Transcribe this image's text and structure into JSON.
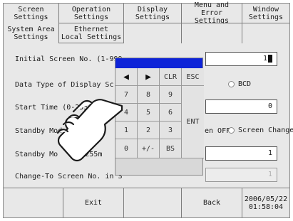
{
  "tabs_primary": [
    {
      "label": "Screen\nSettings"
    },
    {
      "label": "Operation\nSettings"
    },
    {
      "label": "Display\nSettings"
    },
    {
      "label": "Menu and\nError Settings"
    },
    {
      "label": "Window\nSettings"
    }
  ],
  "tabs_secondary": [
    {
      "label": "System Area\nSettings"
    },
    {
      "label": "Ethernet\nLocal Settings"
    }
  ],
  "settings": {
    "initial_screen_label": "Initial Screen No. (1-999",
    "initial_screen_value": "1",
    "data_type_label": "Data Type of Display Scre",
    "data_type_option_bcd": "BCD",
    "start_time_label": "Start Time (0-255",
    "start_time_label_tail": "c):",
    "start_time_value": "0",
    "standby_mode_label": "Standby Mode S",
    "standby_option_off": "en OFF",
    "standby_option_change": "Screen Change",
    "standby_time_label": "Standby Mo",
    "standby_time_label_tail": "1-255m",
    "standby_time_value": "1",
    "change_to_label": "Change-To Screen No. in S",
    "change_to_value": "1"
  },
  "keypad": {
    "left_arrow": "◀",
    "right_arrow": "▶",
    "clr": "CLR",
    "esc": "ESC",
    "k7": "7",
    "k8": "8",
    "k9": "9",
    "k4": "4",
    "k5": "5",
    "k6": "6",
    "k1": "1",
    "k2": "2",
    "k3": "3",
    "k0": "0",
    "plus_minus": "+/-",
    "bs": "BS",
    "ent": "ENT"
  },
  "bottom_bar": {
    "exit": "Exit",
    "back": "Back",
    "date": "2006/05/22",
    "time": "01:58:04"
  },
  "colors": {
    "keypad_title_bar": "#0d23d8",
    "panel_bg": "#e8e8e8"
  }
}
